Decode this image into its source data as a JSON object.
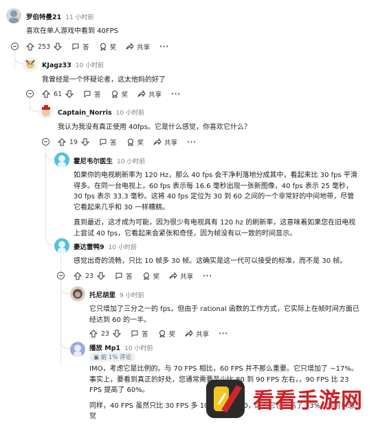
{
  "actions": {
    "reply": "答",
    "award": "奖",
    "share": "共享",
    "more": "···"
  },
  "comments": [
    {
      "author": "罗伯特曼21",
      "time": "11 小时前",
      "body": [
        "喜欢在单人游戏中看到 40FPS"
      ],
      "score": "253"
    },
    {
      "author": "KJagz33",
      "time": "10 小时前",
      "body": [
        "我曾经是一个怀疑论者，这太他妈的好了"
      ],
      "score": "61"
    },
    {
      "author": "Captain_Norris",
      "time": "10 小时前",
      "body": [
        "我认为我没有真正使用 40fps。它是什么感觉，你喜欢它什么？"
      ],
      "score": "19"
    },
    {
      "author": "霍尼韦尔医生",
      "time": "10 小时前",
      "body": [
        "如果你的电视刷新率为 120 Hz，那么 40 fps 会干净利落地分成其中，看起来比 30 fps 平滑得多。在同一台电视上，60 fps 表示每 16.6 毫秒出现一张新图像，40 fps 表示 25 毫秒，30 fps 表示 33.3 毫秒。这将 40 fps 定位为 30 到 60 之间的一个非常好的中间地带，尽管它看起来几乎和 30 一样糟糕。",
        "直到最近，这才成为可能，因为很少有电视具有 120 hz 的刷新率，这意味着如果您在旧电视上尝试 40 fps，它看起来会紧张和奇怪，因为帧没有以一致的时间显示。"
      ],
      "score": ""
    },
    {
      "author": "豪达雷鸭9",
      "time": "10 小时前",
      "body": [
        "感觉出奇的流畅，只比 10 帧多 30 帧。这确实是这一代可以接受的标准，而不是 30 帧。"
      ],
      "score": "23"
    },
    {
      "author": "托尼胡里",
      "time": "9 小时前",
      "body": [
        "它只增加了三分之一的 fps，但由于 rational 函数的工作方式，它实际上在帧时间方面已经达到 60 的一半。"
      ],
      "score": "23"
    },
    {
      "author": "播放 Mp1",
      "time": "10 小时前",
      "badge": "前 1% 评论",
      "body": [
        "IMO，考虑它是比例的。与 70 FPS 相比，60 FPS 并不那么重要。它只增加了 ~17%。事实上，要看到真正的好处，您通常需要至少比 80 到 90 FPS 左右，，90 FPS 比 23 FPS 提高了 60%。",
        "同样，40 FPS 虽然只比 30 FPS 多 10 FPS，但 60，因为它也提高了 33%。你可以感觉"
      ],
      "score": ""
    }
  ],
  "watermark": {
    "text": "看看手游网"
  },
  "colors": {
    "watermark": "#cf1f26",
    "muted": "#7c7c7c",
    "thread_line": "#e5e5e5"
  },
  "icons": [
    "upvote-icon",
    "downvote-icon",
    "comment-icon",
    "award-icon",
    "share-icon",
    "collapse-icon"
  ]
}
